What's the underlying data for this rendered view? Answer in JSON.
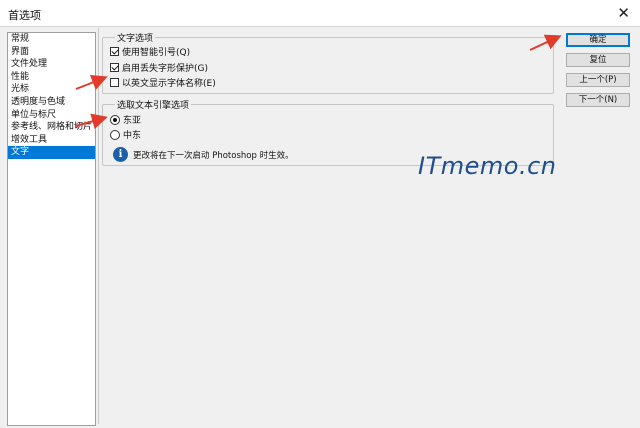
{
  "window": {
    "title": "首选项",
    "close_icon": "close-icon"
  },
  "sidebar": {
    "items": [
      {
        "label": "常规",
        "selected": false
      },
      {
        "label": "界面",
        "selected": false
      },
      {
        "label": "文件处理",
        "selected": false
      },
      {
        "label": "性能",
        "selected": false
      },
      {
        "label": "光标",
        "selected": false
      },
      {
        "label": "透明度与色域",
        "selected": false
      },
      {
        "label": "单位与标尺",
        "selected": false
      },
      {
        "label": "参考线、网格和切片",
        "selected": false
      },
      {
        "label": "增效工具",
        "selected": false
      },
      {
        "label": "文字",
        "selected": true
      }
    ]
  },
  "text_options": {
    "legend": "文字选项",
    "smart_quotes": {
      "label": "使用智能引号(Q)",
      "checked": true
    },
    "missing_glyph": {
      "label": "启用丢失字形保护(G)",
      "checked": true
    },
    "english_font_names": {
      "label": "以英文显示字体名称(E)",
      "checked": false
    }
  },
  "engine_options": {
    "legend": "选取文本引擎选项",
    "east_asian": {
      "label": "东亚",
      "selected": true
    },
    "middle_east": {
      "label": "中东",
      "selected": false
    },
    "info_text": "更改将在下一次启动 Photoshop 时生效。"
  },
  "buttons": {
    "ok": "确定",
    "reset": "复位",
    "prev": "上一个(P)",
    "next": "下一个(N)"
  },
  "watermark": "ITmemo.cn",
  "colors": {
    "selection": "#0078d7",
    "annotation_arrow": "#e23b2b",
    "watermark": "#1f4e8f"
  }
}
